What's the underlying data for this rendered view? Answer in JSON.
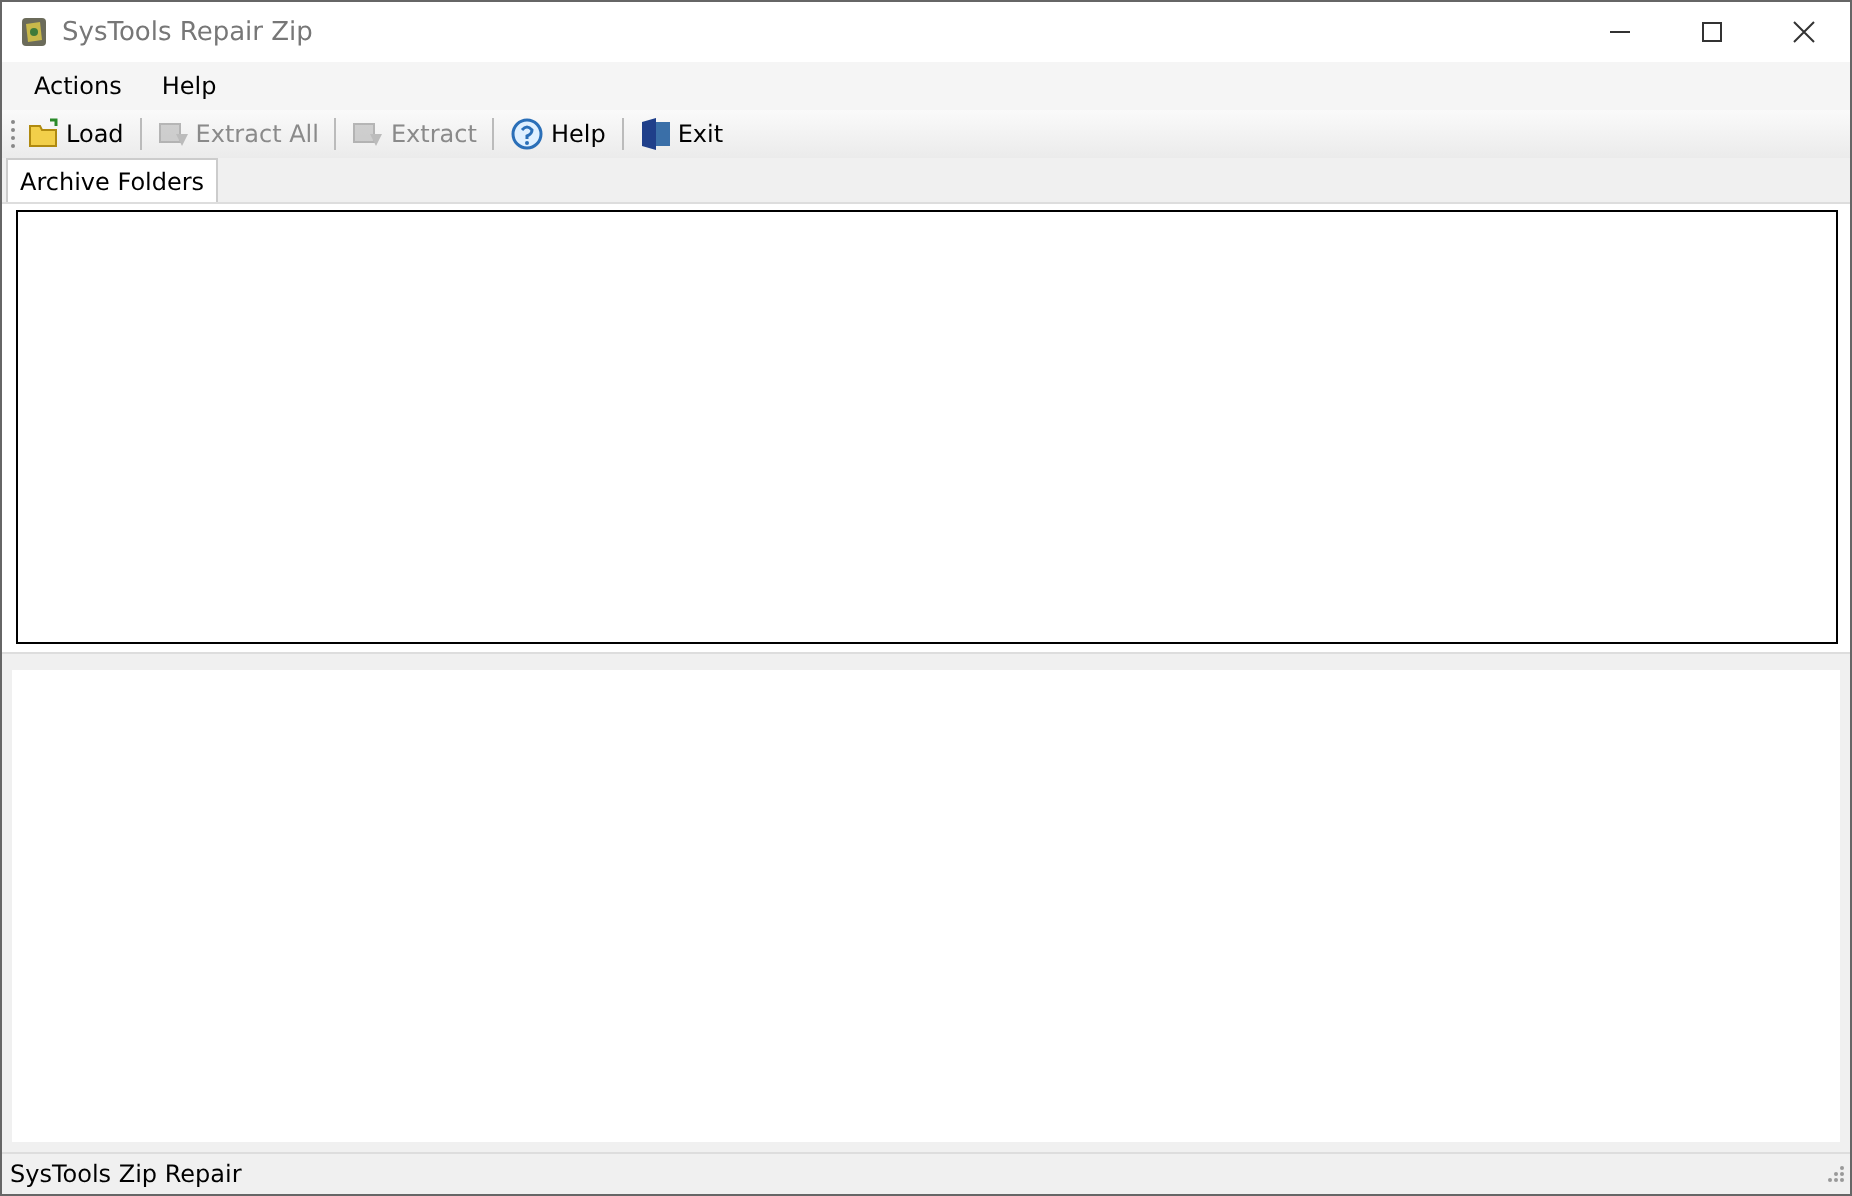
{
  "window": {
    "title": "SysTools Repair Zip"
  },
  "menu": [
    {
      "label": "Actions"
    },
    {
      "label": "Help"
    }
  ],
  "toolbar": [
    {
      "kind": "load",
      "label": "Load",
      "disabled": false
    },
    {
      "kind": "extract_all",
      "label": "Extract All",
      "disabled": true
    },
    {
      "kind": "extract",
      "label": "Extract",
      "disabled": true
    },
    {
      "kind": "help",
      "label": "Help",
      "disabled": false
    },
    {
      "kind": "exit",
      "label": "Exit",
      "disabled": false
    }
  ],
  "tabs": [
    {
      "label": "Archive Folders",
      "selected": true
    }
  ],
  "status_bar": "SysTools Zip Repair"
}
